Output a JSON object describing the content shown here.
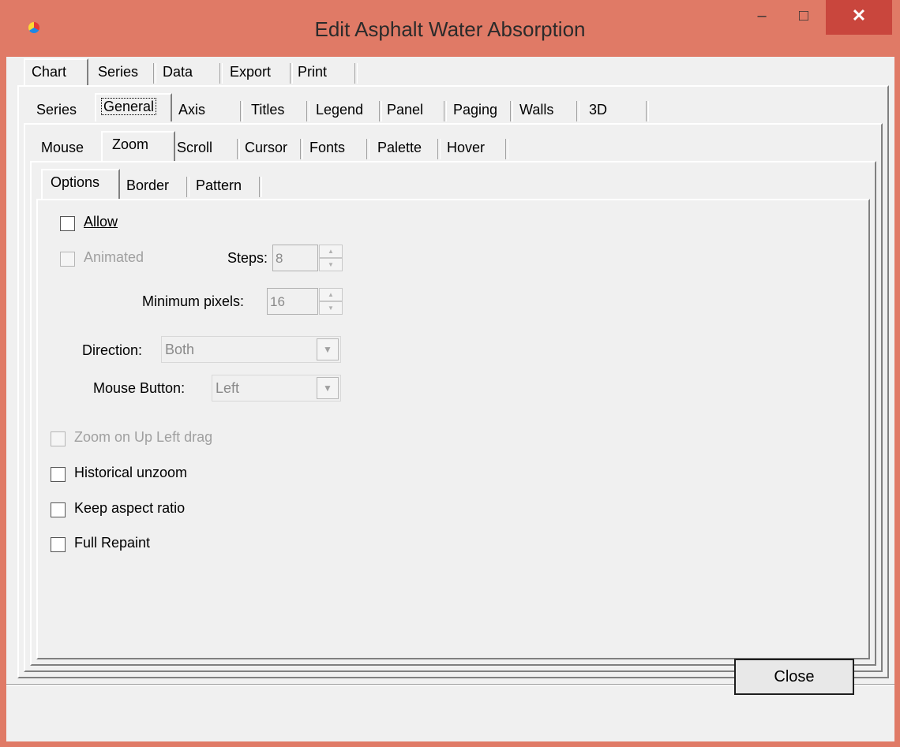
{
  "window": {
    "title": "Edit Asphalt Water Absorption",
    "minimize": "–",
    "maximize": "□",
    "close": "✕"
  },
  "main_tabs": [
    "Chart",
    "Series",
    "Data",
    "Export",
    "Print"
  ],
  "chart_tabs": [
    "Series",
    "General",
    "Axis",
    "Titles",
    "Legend",
    "Panel",
    "Paging",
    "Walls",
    "3D"
  ],
  "general_tabs": [
    "Mouse",
    "Zoom",
    "Scroll",
    "Cursor",
    "Fonts",
    "Palette",
    "Hover"
  ],
  "zoom_tabs": [
    "Options",
    "Border",
    "Pattern"
  ],
  "options": {
    "allow": {
      "label": "Allow",
      "checked": false
    },
    "animated": {
      "label": "Animated",
      "checked": false,
      "enabled": false
    },
    "steps_label": "Steps:",
    "steps_value": "8",
    "min_pixels_label": "Minimum pixels:",
    "min_pixels_value": "16",
    "direction_label": "Direction:",
    "direction_value": "Both",
    "mouse_button_label": "Mouse Button:",
    "mouse_button_value": "Left",
    "zoom_up_left": {
      "label": "Zoom on Up Left drag",
      "checked": false,
      "enabled": false
    },
    "historical_unzoom": {
      "label": "Historical unzoom",
      "checked": false
    },
    "keep_aspect": {
      "label": "Keep aspect ratio",
      "checked": false
    },
    "full_repaint": {
      "label": "Full Repaint",
      "checked": false
    }
  },
  "footer": {
    "close_label": "Close"
  },
  "colors": {
    "title_bar": "#e07a66",
    "close_button": "#c9463d",
    "dialog_bg": "#f0f0f0"
  }
}
